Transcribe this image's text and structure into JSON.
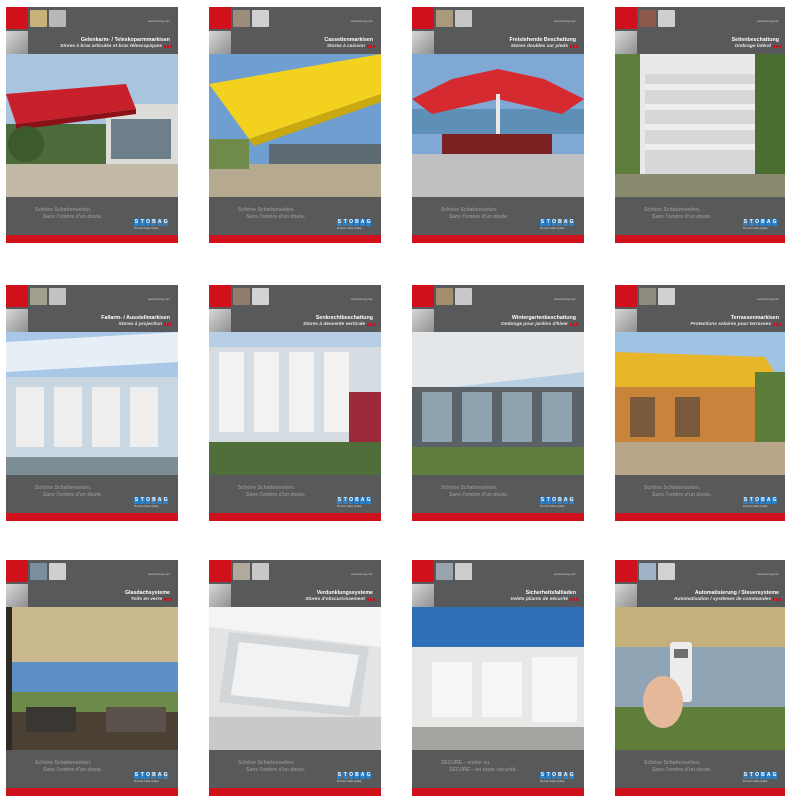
{
  "url": "www.storag.com",
  "logo": {
    "letters": [
      "S",
      "T",
      "O",
      "B",
      "A",
      "G"
    ],
    "tag": "Premium Swiss Quality"
  },
  "cards": [
    {
      "title": "Gelenkarm- / Teleskoparmmarkisen",
      "subtitle": "Stores à bras articulés et bras télescopiques",
      "slogan1": "Schöne Schattenseiten.",
      "slogan2": "Sans l'ombre d'un doute.",
      "photo": "red-awning-terrace"
    },
    {
      "title": "Cassettenmarkisen",
      "subtitle": "Stores à caisson",
      "slogan1": "Schöne Schattenseiten.",
      "slogan2": "Sans l'ombre d'un doute.",
      "photo": "yellow-cassette-awning"
    },
    {
      "title": "Freistehende Beschattung",
      "subtitle": "Stores doubles sur pieds",
      "slogan1": "Schöne Schattenseiten.",
      "slogan2": "Sans l'ombre d'un doute.",
      "photo": "freestanding-red-umbrella-lake"
    },
    {
      "title": "Seitenbeschattung",
      "subtitle": "Ombrage latéral",
      "slogan1": "Schöne Schattenseiten.",
      "slogan2": "Sans l'ombre d'un doute.",
      "photo": "side-screen-garden"
    },
    {
      "title": "Fallarm- / Ausstellmarkisen",
      "subtitle": "Stores à projection",
      "slogan1": "Schöne Schattenseiten.",
      "slogan2": "Sans l'ombre d'un doute.",
      "photo": "glass-facade-drop-arm"
    },
    {
      "title": "Senkrechtbeschattung",
      "subtitle": "Stores à descente verticale",
      "slogan1": "Schöne Schattenseiten.",
      "slogan2": "Sans l'ombre d'un doute.",
      "photo": "vertical-screens-building"
    },
    {
      "title": "Wintergartenbeschattung",
      "subtitle": "Ombrage pour jardins d'hiver",
      "slogan1": "Schöne Schattenseiten.",
      "slogan2": "Sans l'ombre d'un doute.",
      "photo": "winter-garden-glass"
    },
    {
      "title": "Terrassenmarkisen",
      "subtitle": "Protections solaires pour terrasses",
      "slogan1": "Schöne Schattenseiten.",
      "slogan2": "Sans l'ombre d'un doute.",
      "photo": "terrace-yellow-awning"
    },
    {
      "title": "Glasdachsysteme",
      "subtitle": "Toits en verre",
      "slogan1": "Schöne Schattenseiten.",
      "slogan2": "Sans l'ombre d'un doute.",
      "photo": "glass-roof-lounge"
    },
    {
      "title": "Verdunklungssysteme",
      "subtitle": "Stores d'obscurcissement",
      "slogan1": "Schöne Schattenseiten.",
      "slogan2": "Sans l'ombre d'un doute.",
      "photo": "blackout-ceiling"
    },
    {
      "title": "Sicherheitsfaltladen",
      "subtitle": "Volets pliants de sécurité",
      "slogan1": "SECURE – sicher zu.",
      "slogan2": "SECURE – en toute sécurité.",
      "photo": "security-shutter-house"
    },
    {
      "title": "Automatisierung / Steuersysteme",
      "subtitle": "Automatisation / systèmes de commandes",
      "slogan1": "Schöne Schattenseiten.",
      "slogan2": "Sans l'ombre d'un doute.",
      "photo": "remote-control-hand"
    }
  ],
  "colors": {
    "brand_red": "#d0101b",
    "panel_grey": "#58595b",
    "logo_blue": "#2f7fc4"
  }
}
